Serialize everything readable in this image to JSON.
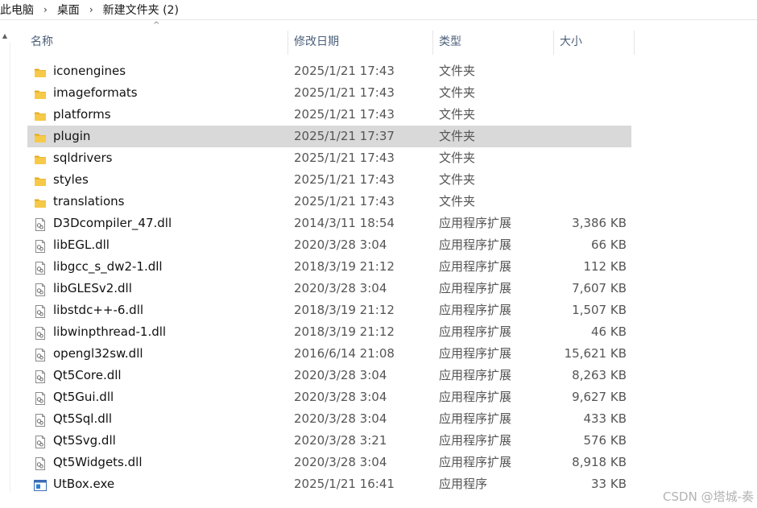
{
  "breadcrumb": [
    "此电脑",
    "桌面",
    "新建文件夹 (2)"
  ],
  "columns": {
    "name": "名称",
    "date": "修改日期",
    "type": "类型",
    "size": "大小"
  },
  "files": [
    {
      "name": "iconengines",
      "date": "2025/1/21 17:43",
      "type": "文件夹",
      "size": "",
      "icon": "folder-icon",
      "selected": false
    },
    {
      "name": "imageformats",
      "date": "2025/1/21 17:43",
      "type": "文件夹",
      "size": "",
      "icon": "folder-icon",
      "selected": false
    },
    {
      "name": "platforms",
      "date": "2025/1/21 17:43",
      "type": "文件夹",
      "size": "",
      "icon": "folder-icon",
      "selected": false
    },
    {
      "name": "plugin",
      "date": "2025/1/21 17:37",
      "type": "文件夹",
      "size": "",
      "icon": "folder-icon",
      "selected": true
    },
    {
      "name": "sqldrivers",
      "date": "2025/1/21 17:43",
      "type": "文件夹",
      "size": "",
      "icon": "folder-icon",
      "selected": false
    },
    {
      "name": "styles",
      "date": "2025/1/21 17:43",
      "type": "文件夹",
      "size": "",
      "icon": "folder-icon",
      "selected": false
    },
    {
      "name": "translations",
      "date": "2025/1/21 17:43",
      "type": "文件夹",
      "size": "",
      "icon": "folder-icon",
      "selected": false
    },
    {
      "name": "D3Dcompiler_47.dll",
      "date": "2014/3/11 18:54",
      "type": "应用程序扩展",
      "size": "3,386 KB",
      "icon": "dll-file-icon",
      "selected": false
    },
    {
      "name": "libEGL.dll",
      "date": "2020/3/28 3:04",
      "type": "应用程序扩展",
      "size": "66 KB",
      "icon": "dll-file-icon",
      "selected": false
    },
    {
      "name": "libgcc_s_dw2-1.dll",
      "date": "2018/3/19 21:12",
      "type": "应用程序扩展",
      "size": "112 KB",
      "icon": "dll-file-icon",
      "selected": false
    },
    {
      "name": "libGLESv2.dll",
      "date": "2020/3/28 3:04",
      "type": "应用程序扩展",
      "size": "7,607 KB",
      "icon": "dll-file-icon",
      "selected": false
    },
    {
      "name": "libstdc++-6.dll",
      "date": "2018/3/19 21:12",
      "type": "应用程序扩展",
      "size": "1,507 KB",
      "icon": "dll-file-icon",
      "selected": false
    },
    {
      "name": "libwinpthread-1.dll",
      "date": "2018/3/19 21:12",
      "type": "应用程序扩展",
      "size": "46 KB",
      "icon": "dll-file-icon",
      "selected": false
    },
    {
      "name": "opengl32sw.dll",
      "date": "2016/6/14 21:08",
      "type": "应用程序扩展",
      "size": "15,621 KB",
      "icon": "dll-file-icon",
      "selected": false
    },
    {
      "name": "Qt5Core.dll",
      "date": "2020/3/28 3:04",
      "type": "应用程序扩展",
      "size": "8,263 KB",
      "icon": "dll-file-icon",
      "selected": false
    },
    {
      "name": "Qt5Gui.dll",
      "date": "2020/3/28 3:04",
      "type": "应用程序扩展",
      "size": "9,627 KB",
      "icon": "dll-file-icon",
      "selected": false
    },
    {
      "name": "Qt5Sql.dll",
      "date": "2020/3/28 3:04",
      "type": "应用程序扩展",
      "size": "433 KB",
      "icon": "dll-file-icon",
      "selected": false
    },
    {
      "name": "Qt5Svg.dll",
      "date": "2020/3/28 3:21",
      "type": "应用程序扩展",
      "size": "576 KB",
      "icon": "dll-file-icon",
      "selected": false
    },
    {
      "name": "Qt5Widgets.dll",
      "date": "2020/3/28 3:04",
      "type": "应用程序扩展",
      "size": "8,918 KB",
      "icon": "dll-file-icon",
      "selected": false
    },
    {
      "name": "UtBox.exe",
      "date": "2025/1/21 16:41",
      "type": "应用程序",
      "size": "33 KB",
      "icon": "exe-file-icon",
      "selected": false
    }
  ],
  "watermark": "CSDN @塔城-奏",
  "colors": {
    "folder": "#f4c542",
    "selected_row": "#d9d9d9",
    "header_text": "#4c607a"
  }
}
